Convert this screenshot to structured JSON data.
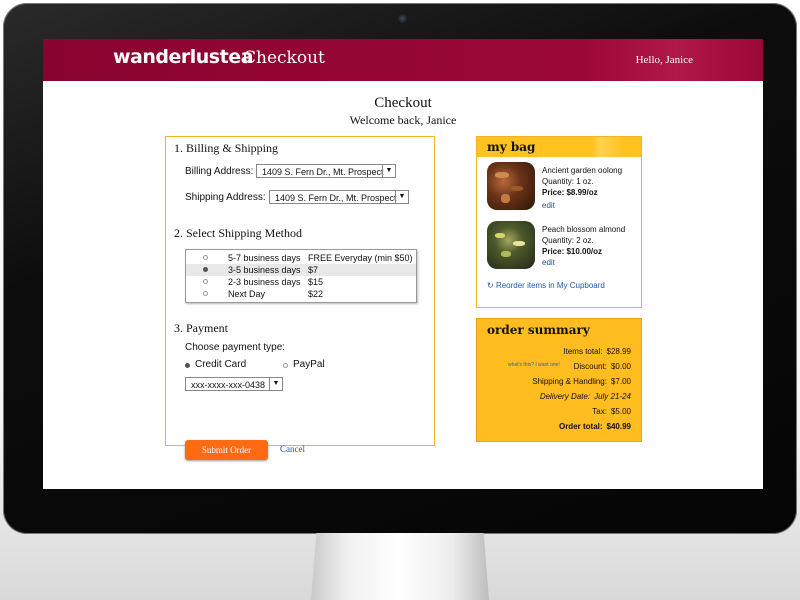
{
  "header": {
    "brand": "wanderlustea",
    "section": "Checkout",
    "greeting": "Hello, Janice"
  },
  "page": {
    "title": "Checkout",
    "subtitle": "Welcome back, Janice"
  },
  "billing": {
    "heading": "1. Billing & Shipping",
    "billing_label": "Billing Address:",
    "billing_value": "1409 S. Fern Dr., Mt. Prospect",
    "shipping_label": "Shipping  Address:",
    "shipping_value": "1409 S. Fern Dr., Mt. Prospect"
  },
  "shipping_method": {
    "heading": "2. Select Shipping Method",
    "options": [
      {
        "days": "5-7 business days",
        "price": "FREE Everyday (min $50)",
        "selected": false
      },
      {
        "days": "3-5 business days",
        "price": "$7",
        "selected": true
      },
      {
        "days": "2-3 business days",
        "price": "$15",
        "selected": false
      },
      {
        "days": "Next Day",
        "price": "$22",
        "selected": false
      }
    ]
  },
  "payment": {
    "heading": "3. Payment",
    "choose_label": "Choose payment type:",
    "credit_label": "Credit Card",
    "paypal_label": "PayPal",
    "card_value": "xxx-xxxx-xxx-0438",
    "submit_label": "Submit Order",
    "cancel_label": "Cancel"
  },
  "bag": {
    "title": "my bag",
    "items": [
      {
        "name": "Ancient garden oolong",
        "quantity": "Quantity: 1 oz.",
        "price": "Price: $8.99/oz",
        "edit": "edit"
      },
      {
        "name": "Peach blossom almond",
        "quantity": "Quantity: 2 oz.",
        "price": "Price: $10.00/oz",
        "edit": "edit"
      }
    ],
    "reorder": "Reorder items in My Cupboard"
  },
  "summary": {
    "title": "order summary",
    "promo": "what's this? I want one!",
    "rows": [
      {
        "label": "Items total:",
        "value": "$28.99"
      },
      {
        "label": "Discount:",
        "value": "$0.00"
      },
      {
        "label": "Shipping & Handling:",
        "value": "$7.00"
      },
      {
        "label": "Delivery Date:",
        "value": "July 21-24"
      },
      {
        "label": "Tax:",
        "value": "$5.00"
      },
      {
        "label": "Order total:",
        "value": "$40.99"
      }
    ]
  },
  "colors": {
    "header_bg": "#9c0836",
    "accent_yellow": "#ffbd1f",
    "submit_orange": "#ff6a13",
    "link_blue": "#2255aa"
  }
}
